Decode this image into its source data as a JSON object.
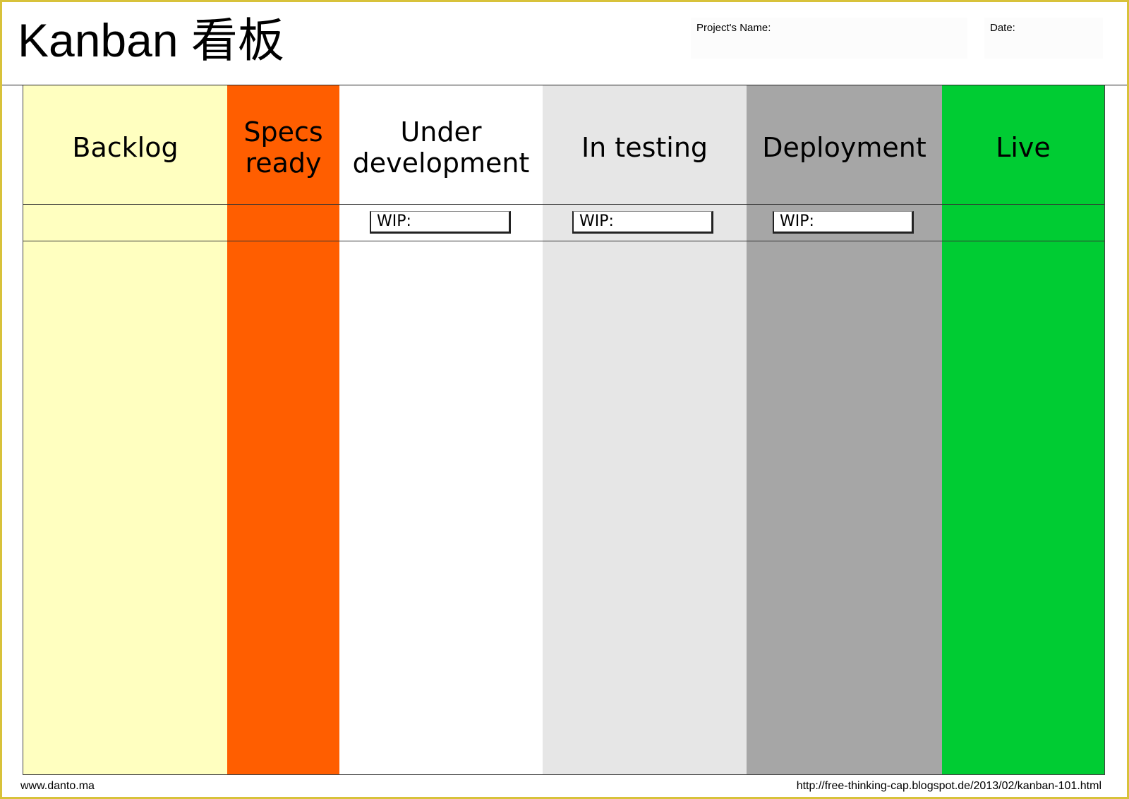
{
  "header": {
    "title": "Kanban 看板",
    "project_label": "Project's Name:",
    "date_label": "Date:"
  },
  "columns": [
    {
      "title": "Backlog",
      "color": "#ffffc0",
      "wip": ""
    },
    {
      "title": "Specs ready",
      "color": "#ff5e00",
      "wip": ""
    },
    {
      "title": "Under development",
      "color": "#ffffff",
      "wip": "WIP:"
    },
    {
      "title": "In testing",
      "color": "#e6e6e6",
      "wip": "WIP:"
    },
    {
      "title": "Deployment",
      "color": "#a6a6a6",
      "wip": "WIP:"
    },
    {
      "title": "Live",
      "color": "#00cc33",
      "wip": ""
    }
  ],
  "footer": {
    "left": "www.danto.ma",
    "right": "http://free-thinking-cap.blogspot.de/2013/02/kanban-101.html"
  },
  "colors": {
    "frame_border": "#d8c23a"
  }
}
